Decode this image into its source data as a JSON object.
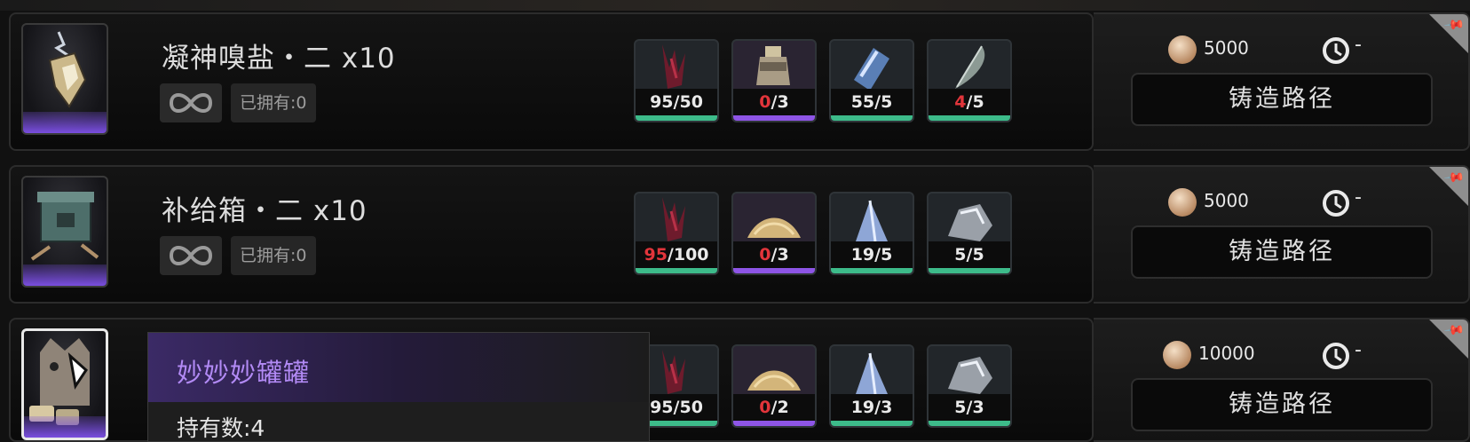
{
  "rows": [
    {
      "name": "凝神嗅盐・二 x10",
      "owned": "已拥有:0",
      "materials": [
        {
          "icon": "red-crystal-icon",
          "have": "95",
          "need": "/50",
          "short": false,
          "bar": "#3dbb8a"
        },
        {
          "icon": "bottle-icon",
          "have": "0",
          "need": "/3",
          "short": true,
          "bar": "#8e55e6"
        },
        {
          "icon": "blue-crystal-icon",
          "have": "55",
          "need": "/5",
          "short": false,
          "bar": "#3dbb8a"
        },
        {
          "icon": "feather-icon",
          "have": "4",
          "need": "/5",
          "short": true,
          "bar": "#3dbb8a"
        }
      ],
      "cost": "5000",
      "time": "-",
      "forge_label": "铸造路径"
    },
    {
      "name": "补给箱・二 x10",
      "owned": "已拥有:0",
      "materials": [
        {
          "icon": "red-crystal-icon",
          "have": "95",
          "need": "/100",
          "short": true,
          "bar": "#3dbb8a"
        },
        {
          "icon": "sand-pile-icon",
          "have": "0",
          "need": "/3",
          "short": true,
          "bar": "#8e55e6"
        },
        {
          "icon": "blue-shard-icon",
          "have": "19",
          "need": "/5",
          "short": false,
          "bar": "#3dbb8a"
        },
        {
          "icon": "silver-ore-icon",
          "have": "5",
          "need": "/5",
          "short": false,
          "bar": "#3dbb8a"
        }
      ],
      "cost": "5000",
      "time": "-",
      "forge_label": "铸造路径"
    },
    {
      "name": "",
      "owned": "",
      "materials": [
        {
          "icon": "red-crystal-icon",
          "have": "95",
          "need": "/50",
          "short": false,
          "bar": "#3dbb8a"
        },
        {
          "icon": "sand-pile-icon",
          "have": "0",
          "need": "/2",
          "short": true,
          "bar": "#8e55e6"
        },
        {
          "icon": "blue-shard-icon",
          "have": "19",
          "need": "/3",
          "short": false,
          "bar": "#3dbb8a"
        },
        {
          "icon": "silver-ore-icon",
          "have": "5",
          "need": "/3",
          "short": false,
          "bar": "#3dbb8a"
        }
      ],
      "cost": "10000",
      "time": "-",
      "forge_label": "铸造路径"
    }
  ],
  "tooltip": {
    "name": "妙妙妙罐罐",
    "count": "持有数:4"
  },
  "colors": {
    "rarity_purple": "#7a4ee0",
    "shortage_red": "#e2353b",
    "tooltip_name": "#b28af5",
    "enough_green": "#3dbb8a"
  }
}
